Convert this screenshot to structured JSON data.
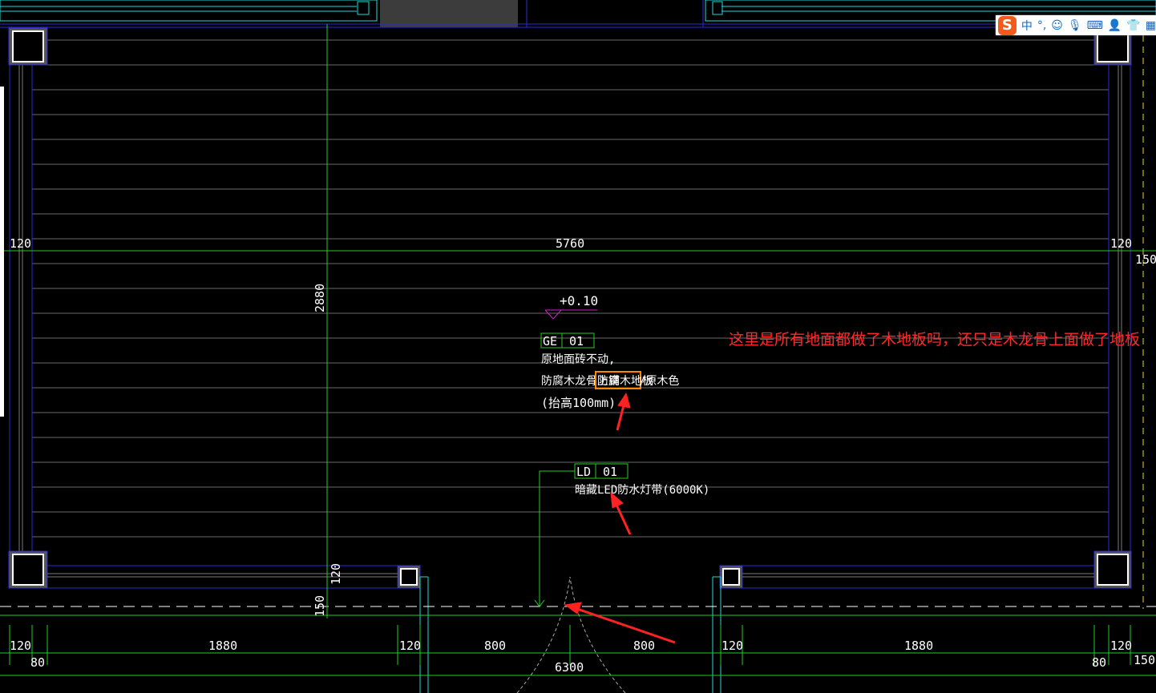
{
  "drawing": {
    "dimensions": {
      "top_left": "120",
      "top_center": "5760",
      "top_right": "120",
      "right_edge": "150",
      "vertical_left": "2880",
      "vertical_bottom_a": "120",
      "vertical_bottom_b": "150",
      "bottom_left_a": "120",
      "bottom_left_b": "80",
      "bottom_span_left": "1880",
      "bottom_door_left": "120",
      "bottom_door_a": "800",
      "bottom_door_b": "800",
      "bottom_total": "6300",
      "bottom_door_right": "120",
      "bottom_span_right": "1880",
      "bottom_right_a": "120",
      "bottom_right_b": "80",
      "bottom_right_edge": "150"
    },
    "level_mark": "+0.10",
    "tag_ge": {
      "code": "GE",
      "num": "01"
    },
    "floor_note_1": "原地面砖不动,",
    "floor_note_2a": "防腐木龙骨上铺",
    "floor_note_2b": "防腐木地板",
    "floor_note_2c": "/原木色",
    "floor_note_3": "(抬高100mm)",
    "tag_ld": {
      "code": "LD",
      "num": "01"
    },
    "led_note_a": "暗藏",
    "led_note_b": "LED防水灯带(6000K)"
  },
  "annotation": {
    "question": "这里是所有地面都做了木地板吗，还只是木龙骨上面做了地板",
    "arrow_color": "#ff2222"
  },
  "ime_toolbar": {
    "logo": "S",
    "lang": "中",
    "punct": "°,",
    "items": [
      "emoji-icon",
      "mic-icon",
      "keyboard-icon",
      "user-icon",
      "shirt-icon",
      "grid-icon"
    ]
  },
  "colors": {
    "background": "#000000",
    "dimension": "#22cc22",
    "wall": "#2a2ad8",
    "cyan": "#22d8d8",
    "hatch": "#7a7a7a",
    "text": "#ffffff",
    "level_mark": "#cc22cc",
    "highlight_box": "#ff8800"
  }
}
